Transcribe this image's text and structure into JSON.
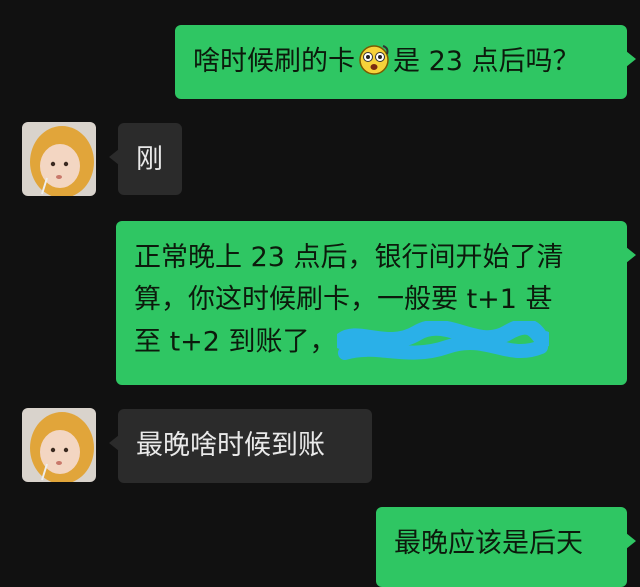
{
  "messages": [
    {
      "side": "out",
      "text_before": "啥时候刷的卡",
      "emoji": "shocked-face",
      "text_after": "是 23 点后吗？"
    },
    {
      "side": "in",
      "text": "刚"
    },
    {
      "side": "out",
      "lines": [
        "正常晚上 23 点后，银行间开始了清",
        "算，你这时候刷卡，一般要 t+1 甚",
        "至 t+2 到账了，"
      ],
      "redacted": true
    },
    {
      "side": "in",
      "text": "最晚啥时候到账"
    },
    {
      "side": "out",
      "text": "最晚应该是后天"
    }
  ],
  "colors": {
    "background": "#111111",
    "outgoing_bubble": "#2fc663",
    "incoming_bubble": "#2b2b2b",
    "redaction": "#2ab0e8"
  }
}
